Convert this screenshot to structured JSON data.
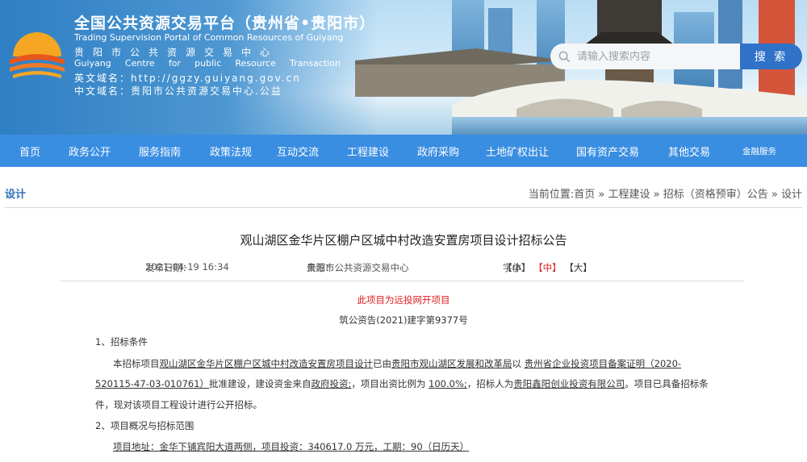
{
  "header": {
    "title_cn": "全国公共资源交易平台（贵州省•贵阳市）",
    "title_en": "Trading Supervision Portal of Common Resources of Guiyang",
    "org_cn": "贵阳市公共资源交易中心",
    "org_en_words": [
      "Guiyang",
      "Centre",
      "for",
      "public",
      "Resource",
      "Transaction"
    ],
    "en_domain_label": "英文域名：",
    "en_domain": "http://ggzy.guiyang.gov.cn",
    "cn_domain_label": "中文域名：",
    "cn_domain": "贵阳市公共资源交易中心.公益"
  },
  "search": {
    "placeholder": "请输入搜索内容",
    "button_label": "搜 索"
  },
  "nav": {
    "items": [
      {
        "label": "首页"
      },
      {
        "label": "政务公开"
      },
      {
        "label": "服务指南"
      },
      {
        "label": "政策法规"
      },
      {
        "label": "互动交流"
      },
      {
        "label": "工程建设"
      },
      {
        "label": "政府采购"
      },
      {
        "label": "土地矿权出让"
      },
      {
        "label": "国有资产交易"
      },
      {
        "label": "其他交易"
      },
      {
        "label": "金融服务"
      }
    ]
  },
  "breadcrumb": {
    "section_title": "设计",
    "prefix": "当前位置:",
    "items": [
      "首页",
      "工程建设",
      "招标（资格预审）公告",
      "设计"
    ],
    "separator": " » "
  },
  "article": {
    "title": "观山湖区金华片区棚户区城中村改造安置房项目设计招标公告",
    "publish_label": "发布日期：",
    "publish_date": "2021-04-19 16:34",
    "source_label": "来源：",
    "source": "贵阳市公共资源交易中心",
    "font_label": "字体：",
    "font_small": "【小】",
    "font_medium": "【中】",
    "font_large": "【大】",
    "notice": "此项目为远投网开项目",
    "doc_no": "筑公资告(2021)建字第9377号",
    "section1_heading": "1、招标条件",
    "p1_a": "本招标项目",
    "p1_project": "观山湖区金华片区棚户区城中村改造安置房项目设计",
    "p1_b": "已由",
    "p1_dept": "贵阳市观山湖区发展和改革局",
    "p1_c": "以",
    "p1_cert_1": "贵州省企业投资项目备案证明（2020-",
    "p1_cert_2": "520115-47-03-010761）",
    "p1_d": "批准建设，建设资金来自",
    "p1_fund": "政府投资;",
    "p1_e": "，项目出资比例为",
    "p1_ratio": "100.0%;",
    "p1_f": "，招标人为",
    "p1_tenderer": "贵阳鑫阳创业投资有限公司",
    "p1_g": "。项目已具备招标条",
    "p1_h": "件，现对该项目工程设计进行公开招标。",
    "section2_heading": "2、项目概况与招标范围",
    "p2": "项目地址：金华下铺宾阳大道两侧，项目投资：340617.0 万元，工期：90（日历天）"
  },
  "colors": {
    "nav_bg": "#3a8ee2",
    "search_button": "#2f72c8",
    "section_title": "#2f6fb8",
    "notice_red": "#e02020",
    "font_active": "#dd2222"
  }
}
